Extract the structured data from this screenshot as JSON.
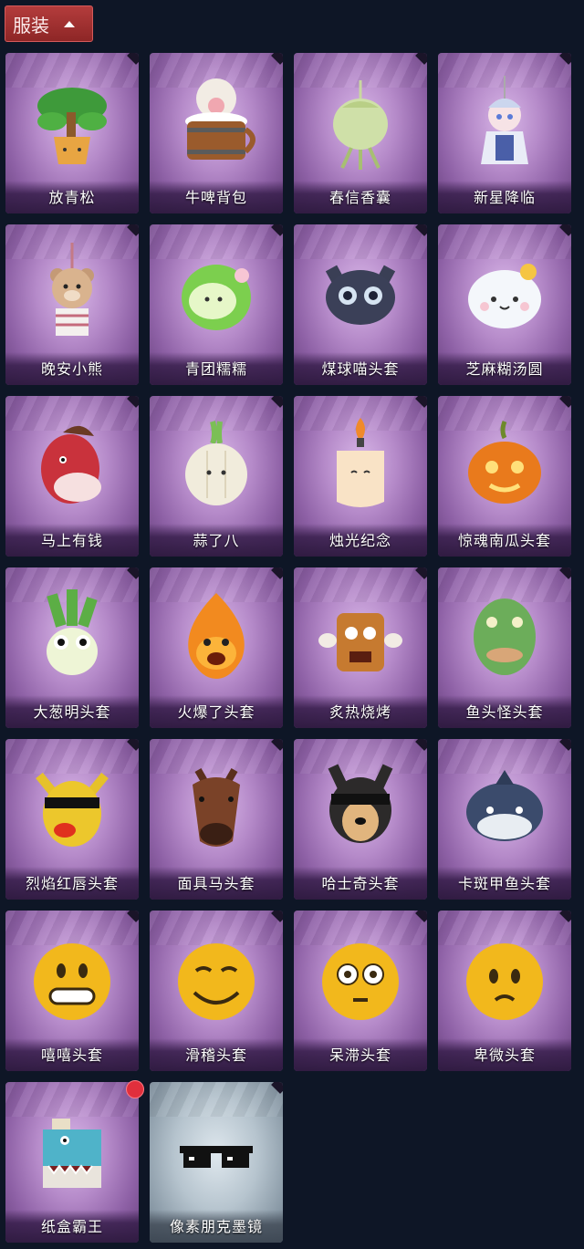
{
  "header": {
    "tab_label": "服装"
  },
  "items": [
    {
      "name": "放青松",
      "icon": "bonsai-pine-icon",
      "bg": "purple"
    },
    {
      "name": "牛啤背包",
      "icon": "cow-beer-barrel-icon",
      "bg": "purple"
    },
    {
      "name": "春信香囊",
      "icon": "sachet-icon",
      "bg": "purple"
    },
    {
      "name": "新星降临",
      "icon": "figurine-keychain-icon",
      "bg": "purple"
    },
    {
      "name": "晚安小熊",
      "icon": "teddy-bear-keychain-icon",
      "bg": "purple"
    },
    {
      "name": "青团糯糯",
      "icon": "green-rice-ball-icon",
      "bg": "purple"
    },
    {
      "name": "煤球喵头套",
      "icon": "black-cat-head-icon",
      "bg": "purple"
    },
    {
      "name": "芝麻糊汤圆",
      "icon": "rice-dumpling-head-icon",
      "bg": "purple"
    },
    {
      "name": "马上有钱",
      "icon": "red-horse-head-icon",
      "bg": "purple"
    },
    {
      "name": "蒜了八",
      "icon": "garlic-head-icon",
      "bg": "purple"
    },
    {
      "name": "烛光纪念",
      "icon": "candle-head-icon",
      "bg": "purple"
    },
    {
      "name": "惊魂南瓜头套",
      "icon": "pumpkin-head-icon",
      "bg": "purple"
    },
    {
      "name": "大葱明头套",
      "icon": "scallion-head-icon",
      "bg": "purple"
    },
    {
      "name": "火爆了头套",
      "icon": "fire-head-icon",
      "bg": "purple"
    },
    {
      "name": "炙热烧烤",
      "icon": "grilled-meat-head-icon",
      "bg": "purple"
    },
    {
      "name": "鱼头怪头套",
      "icon": "fish-head-icon",
      "bg": "purple"
    },
    {
      "name": "烈焰红唇头套",
      "icon": "yellow-mascot-head-icon",
      "bg": "purple"
    },
    {
      "name": "面具马头套",
      "icon": "horse-mask-icon",
      "bg": "purple"
    },
    {
      "name": "哈士奇头套",
      "icon": "husky-head-icon",
      "bg": "purple"
    },
    {
      "name": "卡斑甲鱼头套",
      "icon": "round-fish-head-icon",
      "bg": "purple"
    },
    {
      "name": "嘻嘻头套",
      "icon": "grin-emoji-head-icon",
      "bg": "purple"
    },
    {
      "name": "滑稽头套",
      "icon": "smirk-emoji-head-icon",
      "bg": "purple"
    },
    {
      "name": "呆滞头套",
      "icon": "dazed-emoji-head-icon",
      "bg": "purple"
    },
    {
      "name": "卑微头套",
      "icon": "pleading-emoji-head-icon",
      "bg": "purple"
    },
    {
      "name": "纸盒霸王",
      "icon": "cardboard-dino-icon",
      "bg": "purple",
      "badge": true
    },
    {
      "name": "像素朋克墨镜",
      "icon": "pixel-sunglasses-icon",
      "bg": "silver"
    }
  ],
  "colors": {
    "page_bg": "#0e1626",
    "tab_red": "#a93232",
    "badge_red": "#e02f3c"
  }
}
